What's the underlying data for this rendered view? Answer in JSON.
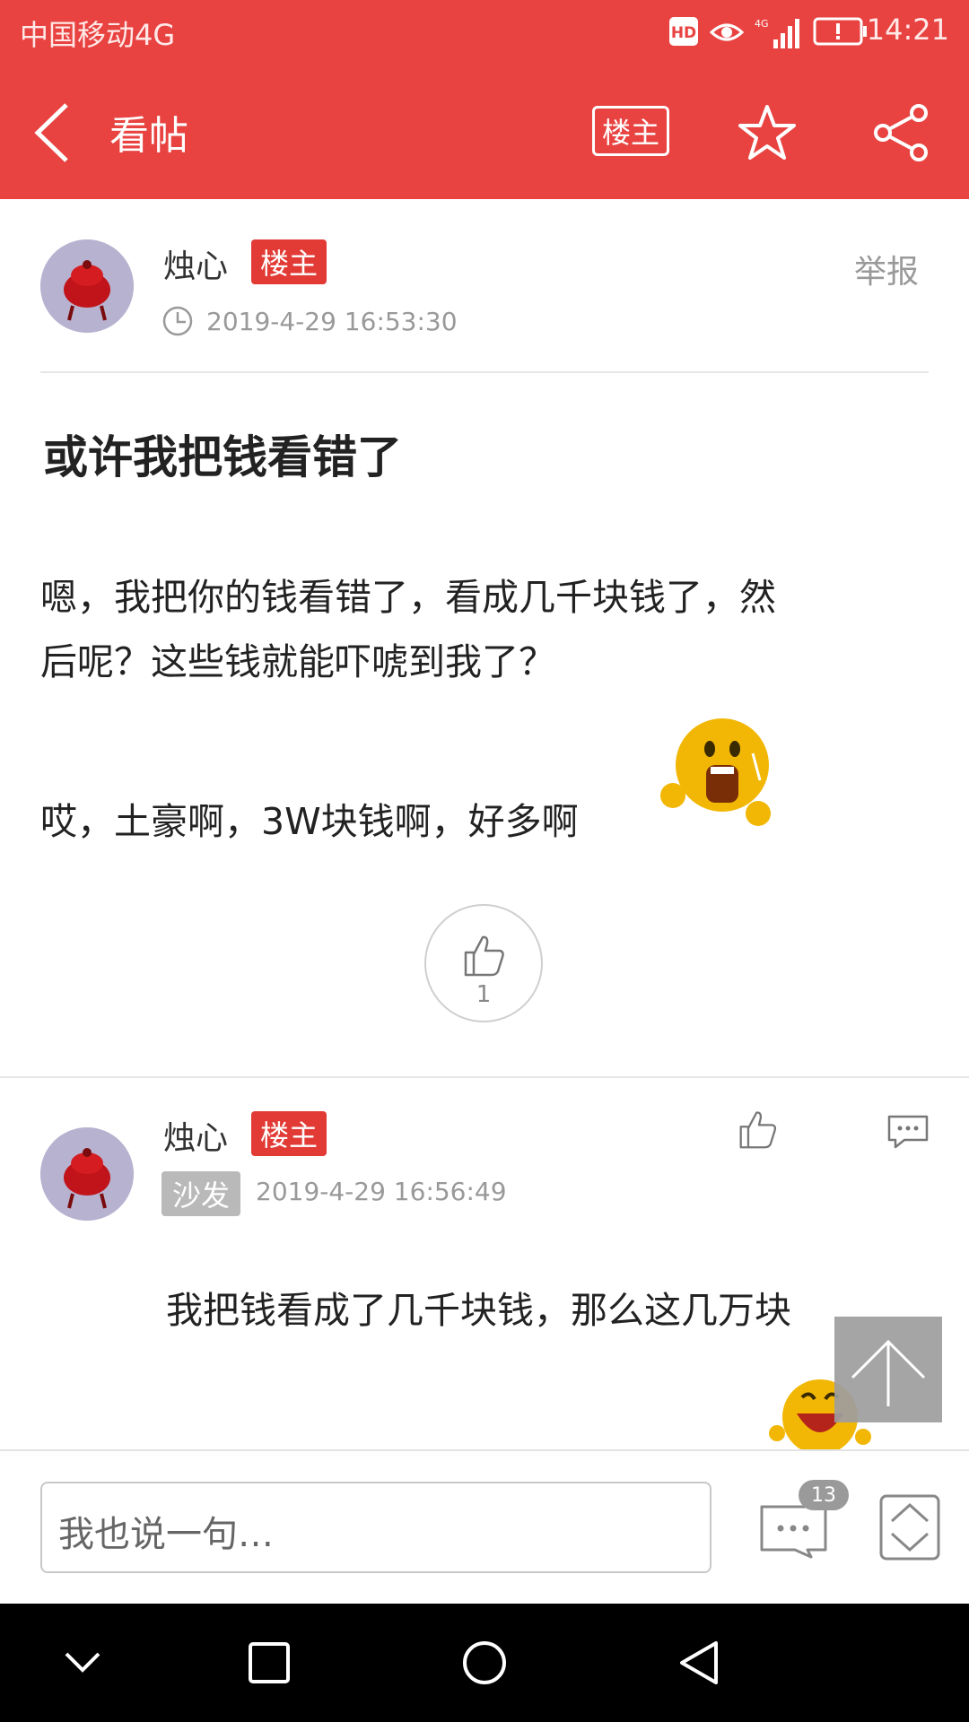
{
  "status_bar": {
    "carrier": "中国移动4G",
    "time": "14:21",
    "hd_label": "HD",
    "network_label": "4G",
    "icons": [
      "hd-icon",
      "eye-icon",
      "signal-icon",
      "battery-icon"
    ]
  },
  "header": {
    "title": "看帖",
    "owner_button": "楼主",
    "icons": [
      "back-icon",
      "star-icon",
      "share-icon"
    ]
  },
  "post": {
    "author": "烛心",
    "author_badge": "楼主",
    "timestamp": "2019-4-29 16:53:30",
    "report": "举报",
    "title": "或许我把钱看错了",
    "paragraph1_line1": "嗯，我把你的钱看错了，看成几千块钱了，然",
    "paragraph1_line2": "后呢？这些钱就能吓唬到我了？",
    "paragraph2": "哎，土豪啊，3W块钱啊，好多啊",
    "like_count": "1"
  },
  "reply": {
    "author": "烛心",
    "author_badge": "楼主",
    "floor_label": "沙发",
    "timestamp": "2019-4-29 16:56:49",
    "text_line1": "我把钱看成了几千块钱，那么这几万块"
  },
  "bottom_bar": {
    "input_placeholder": "我也说一句…",
    "comment_count": "13"
  },
  "colors": {
    "brand_red": "#e84340",
    "badge_red": "#e23a35",
    "gray_text": "#999999"
  }
}
